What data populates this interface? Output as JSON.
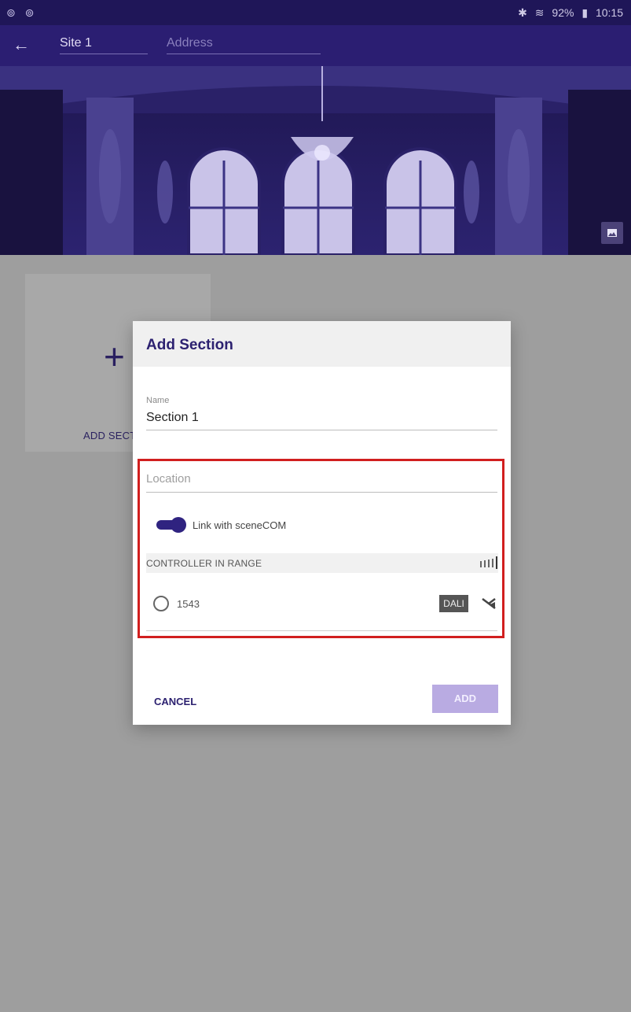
{
  "status_bar": {
    "left_icons": "⊚ ⊚",
    "bluetooth": "✱",
    "wifi": "≋",
    "battery": "92%",
    "time": "10:15"
  },
  "app_bar": {
    "site_name": "Site 1",
    "address_placeholder": "Address"
  },
  "background": {
    "add_card_plus": "+",
    "add_card_label": "ADD SECT"
  },
  "dialog": {
    "title": "Add Section",
    "name_label": "Name",
    "name_value": "Section 1",
    "location_placeholder": "Location",
    "toggle_label": "Link with sceneCOM",
    "toggle_on": true,
    "controllers_title": "CONTROLLER IN RANGE",
    "controllers": [
      {
        "id": "1543",
        "badge": "DALI"
      }
    ],
    "cancel_label": "CANCEL",
    "add_label": "ADD"
  },
  "colors": {
    "primary": "#2b1e72",
    "accent": "#2f2380",
    "highlight_border": "#d11f1f",
    "disabled_button": "#b9abe2"
  }
}
